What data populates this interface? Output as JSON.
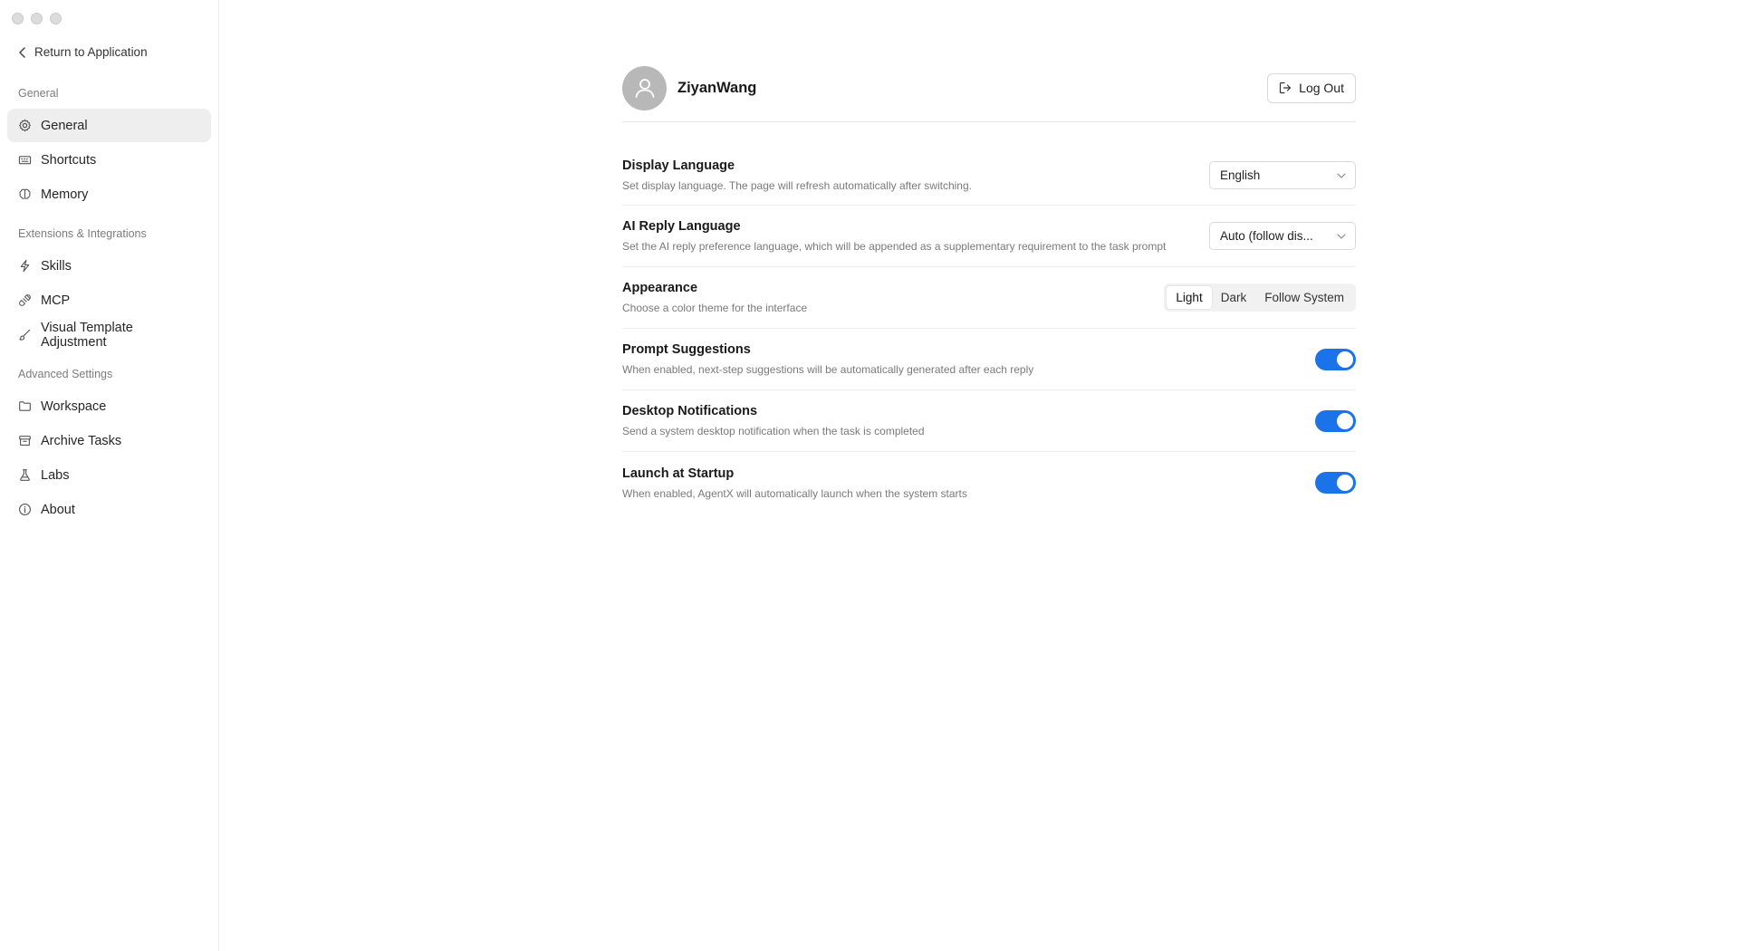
{
  "sidebar": {
    "back_label": "Return to Application",
    "sections": [
      {
        "label": "General",
        "items": [
          {
            "label": "General",
            "icon": "gear-icon"
          },
          {
            "label": "Shortcuts",
            "icon": "keyboard-icon"
          },
          {
            "label": "Memory",
            "icon": "brain-icon"
          }
        ]
      },
      {
        "label": "Extensions & Integrations",
        "items": [
          {
            "label": "Skills",
            "icon": "lightning-icon"
          },
          {
            "label": "MCP",
            "icon": "plug-icon"
          },
          {
            "label": "Visual Template Adjustment",
            "icon": "brush-icon"
          }
        ]
      },
      {
        "label": "Advanced Settings",
        "items": [
          {
            "label": "Workspace",
            "icon": "folder-icon"
          },
          {
            "label": "Archive Tasks",
            "icon": "archive-icon"
          },
          {
            "label": "Labs",
            "icon": "flask-icon"
          },
          {
            "label": "About",
            "icon": "info-icon"
          }
        ]
      }
    ],
    "active_item": "General"
  },
  "profile": {
    "username": "ZiyanWang",
    "logout_label": "Log Out"
  },
  "settings": {
    "display_language": {
      "title": "Display Language",
      "desc": "Set display language. The page will refresh automatically after switching.",
      "value": "English"
    },
    "ai_reply_language": {
      "title": "AI Reply Language",
      "desc": "Set the AI reply preference language, which will be appended as a supplementary requirement to the task prompt",
      "value": "Auto (follow dis..."
    },
    "appearance": {
      "title": "Appearance",
      "desc": "Choose a color theme for the interface",
      "options": [
        "Light",
        "Dark",
        "Follow System"
      ],
      "selected": "Light"
    },
    "prompt_suggestions": {
      "title": "Prompt Suggestions",
      "desc": "When enabled, next-step suggestions will be automatically generated after each reply",
      "enabled": true
    },
    "desktop_notifications": {
      "title": "Desktop Notifications",
      "desc": "Send a system desktop notification when the task is completed",
      "enabled": true
    },
    "launch_at_startup": {
      "title": "Launch at Startup",
      "desc": "When enabled, AgentX will automatically launch when the system starts",
      "enabled": true
    }
  },
  "colors": {
    "accent": "#1a73e8",
    "active_nav_bg": "#eeeeee",
    "avatar_bg": "#b8b8b8"
  }
}
